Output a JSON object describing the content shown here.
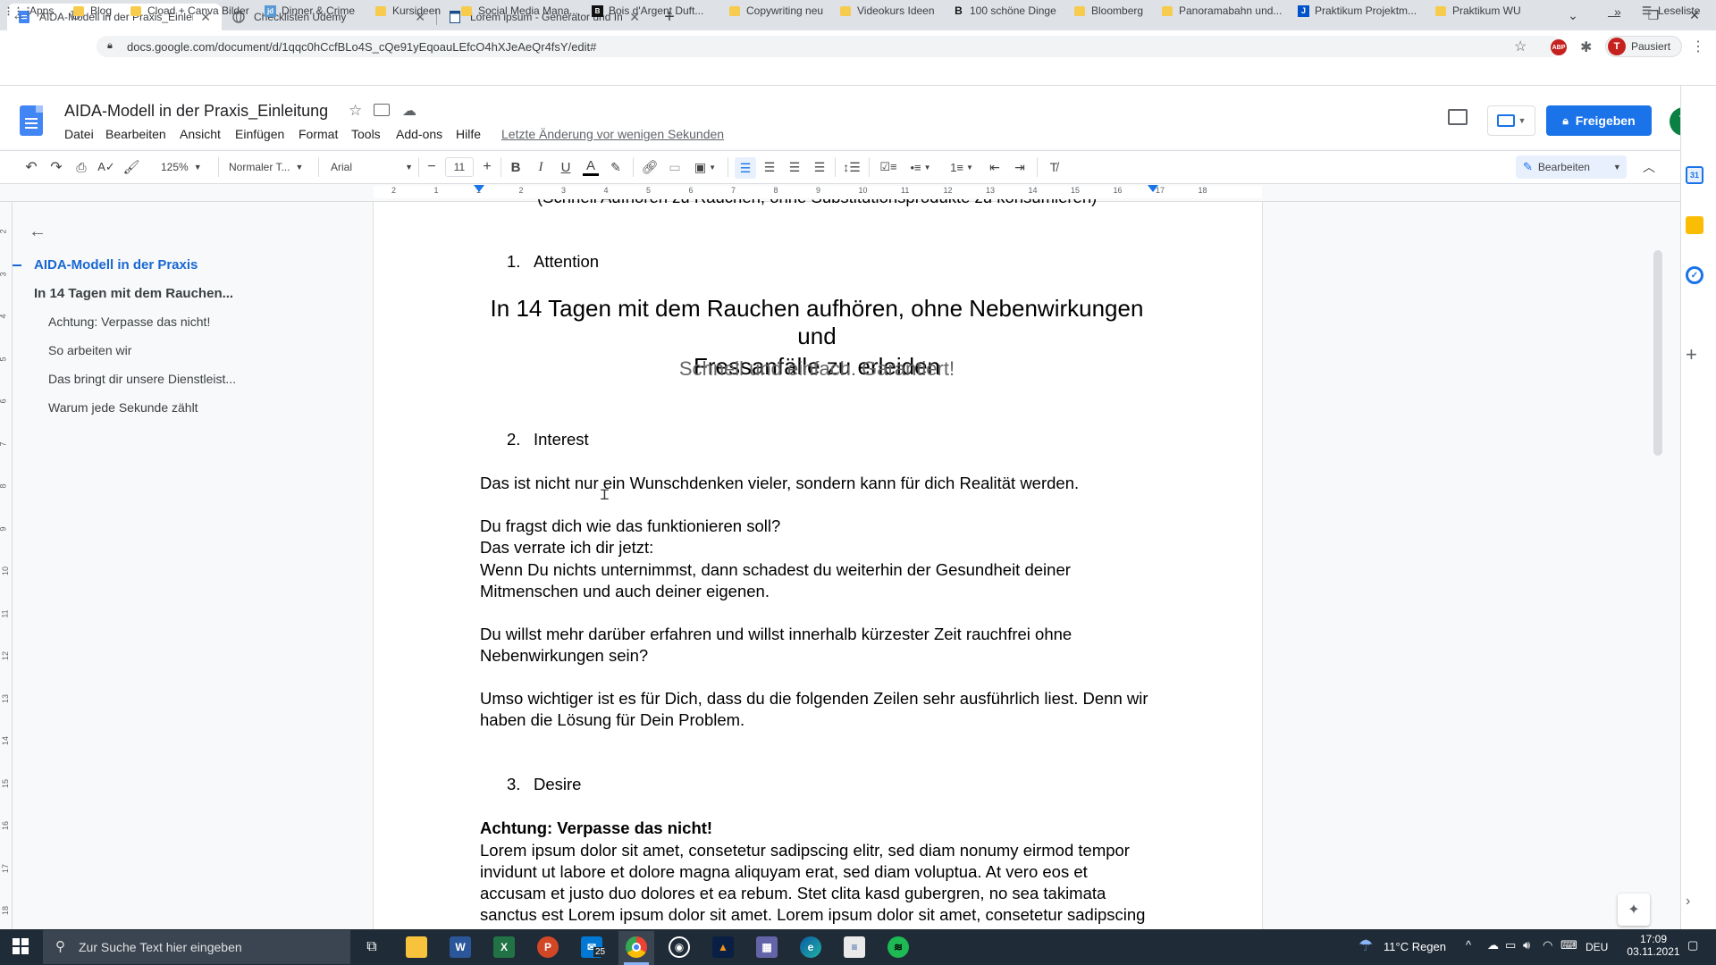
{
  "browser": {
    "tabs": [
      {
        "title": "AIDA-Modell in der Praxis_Einleit",
        "active": true
      },
      {
        "title": "Checklisten Udemy",
        "active": false
      },
      {
        "title": "Lorem ipsum - Generator und Inf",
        "active": false
      }
    ],
    "new_tab": "+",
    "url": "docs.google.com/document/d/1qqc0hCcfBLo4S_cQe91yEqoauLEfcO4hXJeAeQr4fsY/edit#",
    "profile_status": "Pausiert",
    "profile_initial": "T",
    "extension_label": "ABP"
  },
  "bookmarks": {
    "apps": "Apps",
    "items": [
      "Blog",
      "Cload + Canva Bilder",
      "Dinner & Crime",
      "Kursideen",
      "Social Media Mana...",
      "Bois d'Argent Duft...",
      "Copywriting neu",
      "Videokurs Ideen",
      "100 schöne Dinge",
      "Bloomberg",
      "Panoramabahn und...",
      "Praktikum Projektm...",
      "Praktikum WU"
    ],
    "overflow": "»",
    "reading_list": "Leseliste"
  },
  "docs": {
    "title": "AIDA-Modell in der Praxis_Einleitung",
    "menu": [
      "Datei",
      "Bearbeiten",
      "Ansicht",
      "Einfügen",
      "Format",
      "Tools",
      "Add-ons",
      "Hilfe"
    ],
    "last_edit": "Letzte Änderung vor wenigen Sekunden",
    "share": "Freigeben",
    "avatar": "T"
  },
  "toolbar": {
    "zoom": "125%",
    "style": "Normaler T...",
    "font": "Arial",
    "font_size": "11",
    "mode": "Bearbeiten"
  },
  "ruler": {
    "h_ticks": [
      "2",
      "1",
      "1",
      "2",
      "3",
      "4",
      "5",
      "6",
      "7",
      "8",
      "9",
      "10",
      "11",
      "12",
      "13",
      "14",
      "15",
      "16",
      "17",
      "18"
    ],
    "v_ticks": [
      "2",
      "3",
      "4",
      "5",
      "6",
      "7",
      "8",
      "9",
      "10",
      "11",
      "12",
      "13",
      "14",
      "15",
      "16",
      "17",
      "18"
    ]
  },
  "outline": {
    "items": [
      {
        "label": "AIDA-Modell in der Praxis",
        "level": 1
      },
      {
        "label": "In 14 Tagen mit dem Rauchen...",
        "level": 2
      },
      {
        "label": "Achtung: Verpasse das nicht!",
        "level": 3
      },
      {
        "label": "So arbeiten wir",
        "level": 3
      },
      {
        "label": "Das bringt dir unsere Dienstleist...",
        "level": 3
      },
      {
        "label": "Warum jede Sekunde zählt",
        "level": 3
      }
    ]
  },
  "document": {
    "top_cut": "(Schnell Aufhören zu Rauchen, ohne Substitutionsprodukte zu konsumieren)",
    "sections": [
      {
        "num": "1.",
        "title": "Attention"
      },
      {
        "num": "2.",
        "title": "Interest"
      },
      {
        "num": "3.",
        "title": "Desire"
      }
    ],
    "headline_1": "In 14 Tagen mit dem Rauchen aufhören, ohne Nebenwirkungen und",
    "headline_2": "Fressanfälle zu erleiden",
    "subheadline": "Schnell und einfach. Garantiert!",
    "p1": "Das ist nicht nur ein Wunschdenken vieler, sondern kann für dich Realität werden.",
    "p2": "Du fragst dich wie das funktionieren soll?",
    "p3": "Das verrate ich dir jetzt:",
    "p4": "Wenn Du nichts unternimmst, dann schadest du weiterhin der Gesundheit deiner",
    "p5": "Mitmenschen und auch deiner eigenen.",
    "p6": "Du willst mehr darüber erfahren und willst innerhalb kürzester Zeit rauchfrei ohne",
    "p7": "Nebenwirkungen sein?",
    "p8": "Umso wichtiger ist es für Dich, dass du die folgenden Zeilen sehr ausführlich liest. Denn wir",
    "p9": "haben die Lösung für Dein Problem.",
    "bold_heading": "Achtung: Verpasse das nicht!",
    "lorem_1": "Lorem ipsum dolor sit amet, consetetur sadipscing elitr, sed diam nonumy eirmod tempor",
    "lorem_2": "invidunt ut labore et dolore magna aliquyam erat, sed diam voluptua. At vero eos et",
    "lorem_3": "accusam et justo duo dolores et ea rebum. Stet clita kasd gubergren, no sea takimata",
    "lorem_4": "sanctus est Lorem ipsum dolor sit amet. Lorem ipsum dolor sit amet, consetetur sadipscing"
  },
  "taskbar": {
    "search_placeholder": "Zur Suche Text hier eingeben",
    "mail_badge": "25",
    "weather": "11°C  Regen",
    "language": "DEU",
    "time": "17:09",
    "date": "03.11.2021"
  },
  "colors": {
    "accent": "#1a73e8",
    "docs_blue": "#4285f4",
    "outline_active": "#1967d2"
  }
}
